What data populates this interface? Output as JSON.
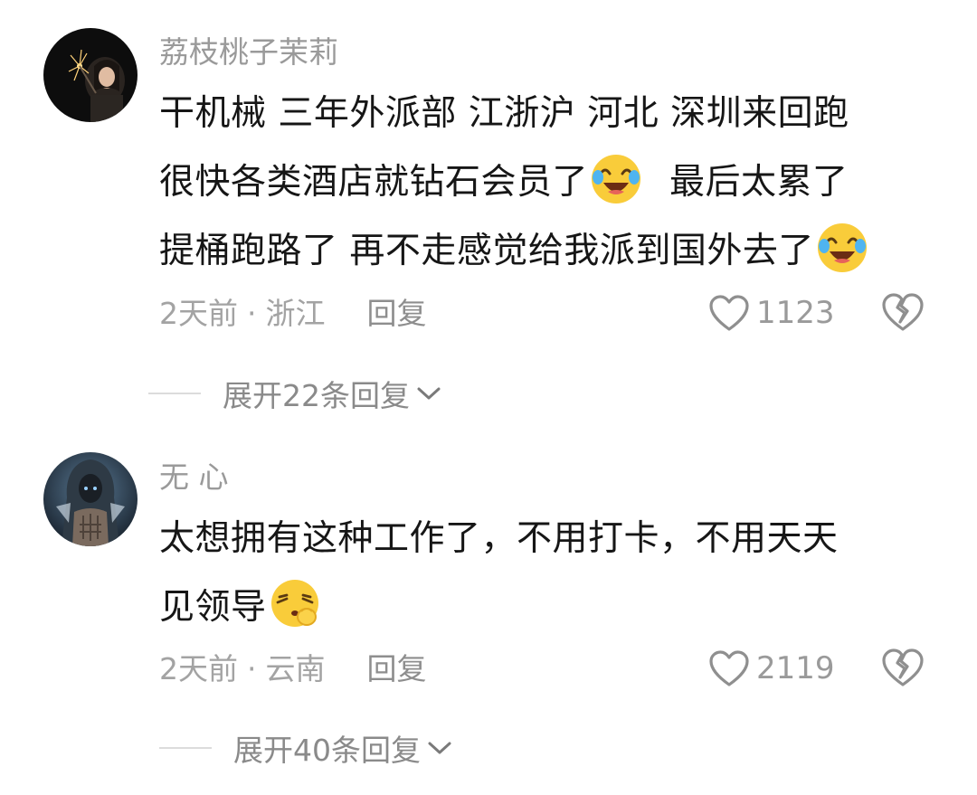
{
  "comments": [
    {
      "username": "荔枝桃子茉莉",
      "lines": [
        "干机械 三年外派部 江浙沪 河北 深圳来回跑",
        "很快各类酒店就钻石会员了",
        "最后太累了",
        "提桶跑路了 再不走感觉给我派到国外去了"
      ],
      "time": "2天前",
      "location": "浙江",
      "reply_label": "回复",
      "likes": "1123",
      "expand_label": "展开22条回复",
      "emojis": [
        "crying-laughing-emoji",
        "crying-laughing-emoji"
      ]
    },
    {
      "username": "无 心",
      "lines": [
        "太想拥有这种工作了，不用打卡，不用天天",
        "见领导"
      ],
      "time": "2天前",
      "location": "云南",
      "reply_label": "回复",
      "likes": "2119",
      "expand_label": "展开40条回复",
      "emojis": [
        "shh-emoji"
      ]
    }
  ],
  "separator": "·",
  "colors": {
    "meta_gray": "#a3a3a3",
    "text_black": "#161616",
    "emoji_yellow": "#f9cc3a"
  }
}
